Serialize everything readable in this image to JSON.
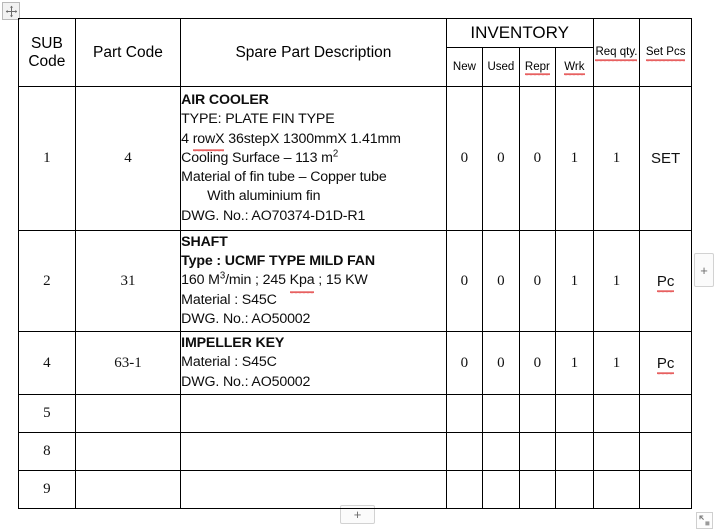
{
  "handles": {
    "move_handle_name": "table-move-handle",
    "resize_handle_name": "table-resize-handle",
    "insert_column_label": "+",
    "insert_row_label": "+"
  },
  "table": {
    "headers": {
      "sub_code": "SUB Code",
      "part_code": "Part Code",
      "description": "Spare Part Description",
      "inventory": "INVENTORY",
      "inventory_sub": [
        "New",
        "Used",
        "Repr",
        "Wrk"
      ],
      "req_qty": "Req qty.",
      "set_pcs": "Set Pcs"
    },
    "rows": [
      {
        "sub_code": "1",
        "part_code": "4",
        "description_lines": [
          {
            "text": "AIR COOLER",
            "bold": true
          },
          {
            "text": "TYPE: PLATE FIN TYPE",
            "bold": false
          },
          {
            "text": "4 rowX 36stepX 1300mmX 1.41mm",
            "bold": false,
            "misspelled": "rowX"
          },
          {
            "text": "Cooling Surface – 113 m2",
            "bold": false,
            "superscript": "2"
          },
          {
            "text": "Material of fin tube – Copper tube",
            "bold": false
          },
          {
            "text": "With aluminium fin",
            "bold": false,
            "indent": true
          },
          {
            "text": "DWG. No.: AO70374-D1D-R1",
            "bold": false
          }
        ],
        "new": "0",
        "used": "0",
        "repr": "0",
        "wrk": "1",
        "req_qty": "1",
        "set_pcs": "SET",
        "set_pcs_misspelled": false
      },
      {
        "sub_code": "2",
        "part_code": "31",
        "description_lines": [
          {
            "text": "SHAFT",
            "bold": true
          },
          {
            "text": "Type : UCMF TYPE MILD FAN",
            "bold": true
          },
          {
            "text": "160 M3/min ; 245 Kpa ; 15 KW",
            "bold": false,
            "superscript": "3",
            "misspelled": "Kpa"
          },
          {
            "text": "Material : S45C",
            "bold": false
          },
          {
            "text": "DWG. No.: AO50002",
            "bold": false
          }
        ],
        "new": "0",
        "used": "0",
        "repr": "0",
        "wrk": "1",
        "req_qty": "1",
        "set_pcs": "Pc",
        "set_pcs_misspelled": true
      },
      {
        "sub_code": "4",
        "part_code": "63-1",
        "description_lines": [
          {
            "text": "IMPELLER KEY",
            "bold": true
          },
          {
            "text": "Material : S45C",
            "bold": false
          },
          {
            "text": "DWG. No.: AO50002",
            "bold": false
          }
        ],
        "new": "0",
        "used": "0",
        "repr": "0",
        "wrk": "1",
        "req_qty": "1",
        "set_pcs": "Pc",
        "set_pcs_misspelled": true
      },
      {
        "sub_code": "5",
        "part_code": "",
        "description_lines": [],
        "new": "",
        "used": "",
        "repr": "",
        "wrk": "",
        "req_qty": "",
        "set_pcs": "",
        "set_pcs_misspelled": false
      },
      {
        "sub_code": "8",
        "part_code": "",
        "description_lines": [],
        "new": "",
        "used": "",
        "repr": "",
        "wrk": "",
        "req_qty": "",
        "set_pcs": "",
        "set_pcs_misspelled": false
      },
      {
        "sub_code": "9",
        "part_code": "",
        "description_lines": [],
        "new": "",
        "used": "",
        "repr": "",
        "wrk": "",
        "req_qty": "",
        "set_pcs": "",
        "set_pcs_misspelled": false
      }
    ]
  },
  "colors": {
    "border": "#000000",
    "text": "#000000",
    "spellcheck_underline": "#e03131",
    "handle_fill": "#f2f2f2"
  }
}
